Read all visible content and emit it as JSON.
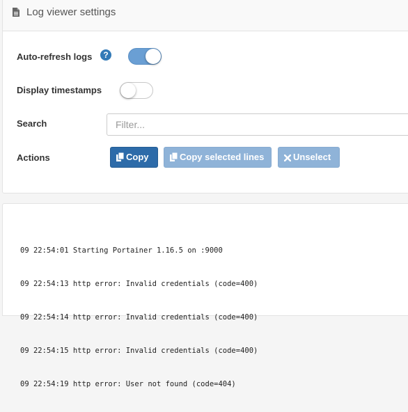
{
  "settings": {
    "title": "Log viewer settings",
    "header_icon": "file-icon",
    "auto_refresh": {
      "label": "Auto-refresh logs",
      "help_icon": "question-circle-icon",
      "help_glyph": "?",
      "enabled": true
    },
    "timestamps": {
      "label": "Display timestamps",
      "enabled": false
    },
    "search": {
      "label": "Search",
      "placeholder": "Filter...",
      "value": ""
    },
    "actions": {
      "label": "Actions",
      "copy_label": "Copy",
      "copy_selected_label": "Copy selected lines",
      "unselect_label": "Unselect",
      "copy_icon": "copy-icon",
      "unselect_icon": "times-icon"
    }
  },
  "colors": {
    "primary": "#2d6ba9",
    "primary_disabled": "#8fb3d8",
    "toggle_on": "#6a9fd4"
  },
  "logs": [
    "09 22:54:01 Starting Portainer 1.16.5 on :9000",
    "09 22:54:13 http error: Invalid credentials (code=400)",
    "09 22:54:14 http error: Invalid credentials (code=400)",
    "09 22:54:15 http error: Invalid credentials (code=400)",
    "09 22:54:19 http error: User not found (code=404)"
  ]
}
